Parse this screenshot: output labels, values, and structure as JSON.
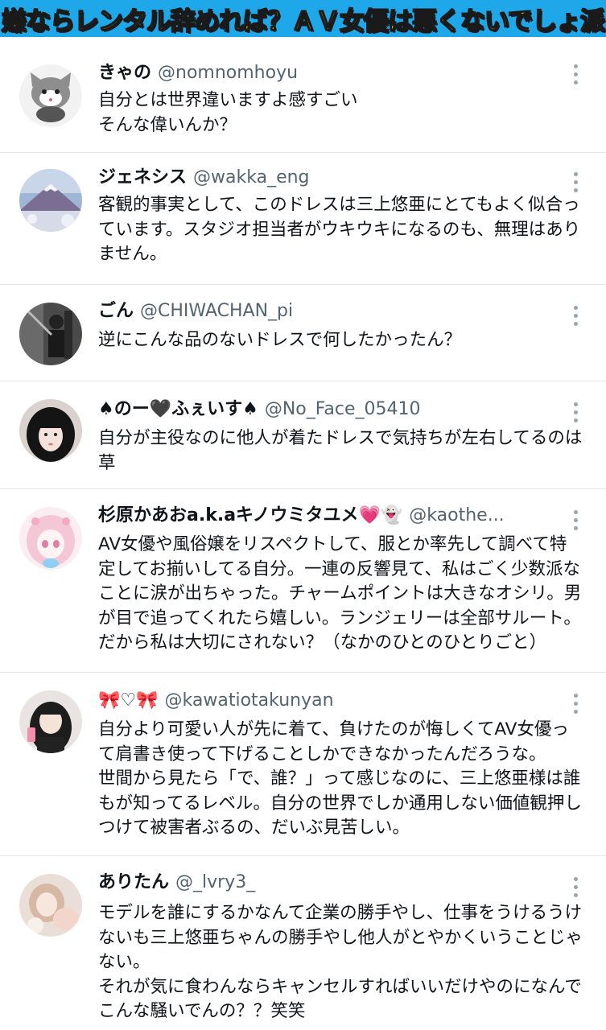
{
  "banner": {
    "title": "嫌ならレンタル辞めれば？ＡＶ女優は悪くないでしょ派"
  },
  "tweets": [
    {
      "name": "きゃの",
      "handle": "@nomnomhoyu",
      "lines": [
        "自分とは世界違いますよ感すごい",
        "そんな偉いんか？"
      ],
      "avatar_icon": "cartoon-cat-icon"
    },
    {
      "name": "ジェネシス",
      "handle": "@wakka_eng",
      "lines": [
        "客観的事実として、このドレスは三上悠亜にとてもよく似合っ",
        "ています。スタジオ担当者がウキウキになるのも、無理はあり",
        "ません。"
      ],
      "avatar_icon": "mount-fuji-icon"
    },
    {
      "name": "ごん",
      "handle": "@CHIWACHAN_pi",
      "lines": [
        "逆にこんな品のないドレスで何したかったん？"
      ],
      "avatar_icon": "photo-monochrome-icon"
    },
    {
      "name": "♠のー🖤ふぇいす♠",
      "handle": "@No_Face_05410",
      "lines": [
        "自分が主役なのに他人が着たドレスで気持ちが左右してるのは",
        "草"
      ],
      "avatar_icon": "portrait-black-hair-icon"
    },
    {
      "name": "杉原かあおa.k.aキノウミタユメ💗👻",
      "handle": "@kaothe...",
      "lines": [
        "AV女優や風俗嬢をリスペクトして、服とか率先して調べて特",
        "定してお揃いしてる自分。一連の反響見て、私はごく少数派な",
        "ことに涙が出ちゃった。チャームポイントは大きなオシリ。男",
        "が目で追ってくれたら嬉しい。ランジェリーは全部サルート。",
        "だから私は大切にされない？（なかのひとのひとりごと）"
      ],
      "avatar_icon": "anime-girl-pink-icon"
    },
    {
      "name": "🎀♡🎀",
      "handle": "@kawatiotakunyan",
      "lines": [
        "自分より可愛い人が先に着て、負けたのが悔しくてAV女優っ",
        "て肩書き使って下げることしかできなかったんだろうな。",
        "世間から見たら「で、誰？」って感じなのに、三上悠亜様は誰",
        "もが知ってるレベル。自分の世界でしか通用しない価値観押し",
        "つけて被害者ぶるの、だいぶ見苦しい。"
      ],
      "avatar_icon": "selfie-girl-icon"
    },
    {
      "name": "ありたん",
      "handle": "@_lvry3_",
      "lines": [
        "モデルを誰にするかなんて企業の勝手やし、仕事をうけるうけ",
        "ないも三上悠亜ちゃんの勝手やし他人がとやかくいうことじゃ",
        "ない。",
        "それが気に食わんならキャンセルすればいいだけやのになんで",
        "こんな騒いでんの？？笑笑"
      ],
      "avatar_icon": "blurred-photo-icon"
    }
  ]
}
